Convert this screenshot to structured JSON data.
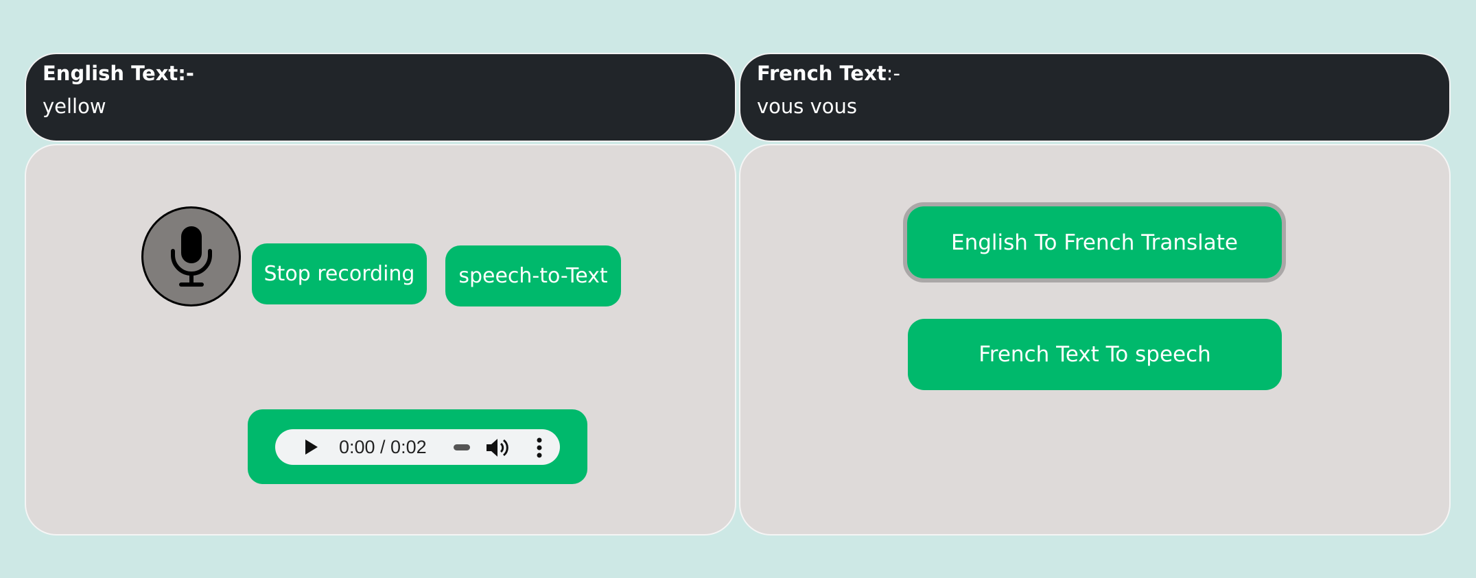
{
  "english_panel": {
    "heading": "English Text:-",
    "text": "yellow"
  },
  "french_panel": {
    "heading_bold": "French Text",
    "heading_rest": ":-",
    "text": "vous vous"
  },
  "controls": {
    "mic_icon": "microphone-icon",
    "stop_label": "Stop recording",
    "stt_label": "speech-to-Text"
  },
  "audio": {
    "time": "0:00 / 0:02"
  },
  "translation": {
    "translate_label": "English To French Translate",
    "tts_label": "French Text To speech"
  },
  "colors": {
    "background": "#cde8e5",
    "panel_dark": "#212529",
    "card": "#dedad9",
    "accent_green": "#00b96c"
  }
}
